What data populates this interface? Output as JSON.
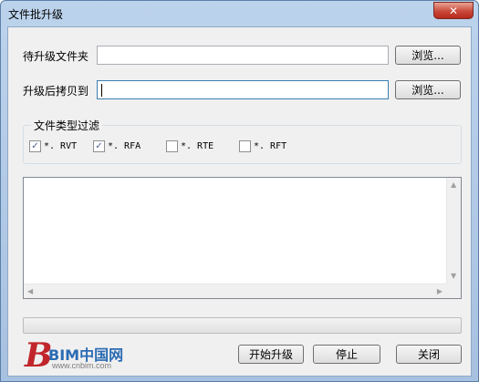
{
  "window": {
    "title": "文件批升级",
    "close_glyph": "✕"
  },
  "form": {
    "source_label": "待升级文件夹",
    "source_value": "",
    "dest_label": "升级后拷贝到",
    "dest_value": "",
    "browse_label_1": "浏览...",
    "browse_label_2": "浏览..."
  },
  "filter": {
    "title": "文件类型过滤",
    "options": [
      {
        "label": "*. RVT",
        "checked": true
      },
      {
        "label": "*. RFA",
        "checked": true
      },
      {
        "label": "*. RTE",
        "checked": false
      },
      {
        "label": "*. RFT",
        "checked": false
      }
    ]
  },
  "progress": {
    "value_percent": 0
  },
  "actions": {
    "start_label": "开始升级",
    "stop_label": "停止",
    "close_label": "关闭"
  },
  "logo": {
    "brand": "BIM中国网",
    "letter": "B",
    "url": "www.cnbim.com"
  },
  "icons": {
    "checkmark": "✓",
    "arrow_up": "▲",
    "arrow_down": "▼",
    "arrow_left": "◀",
    "arrow_right": "▶"
  }
}
